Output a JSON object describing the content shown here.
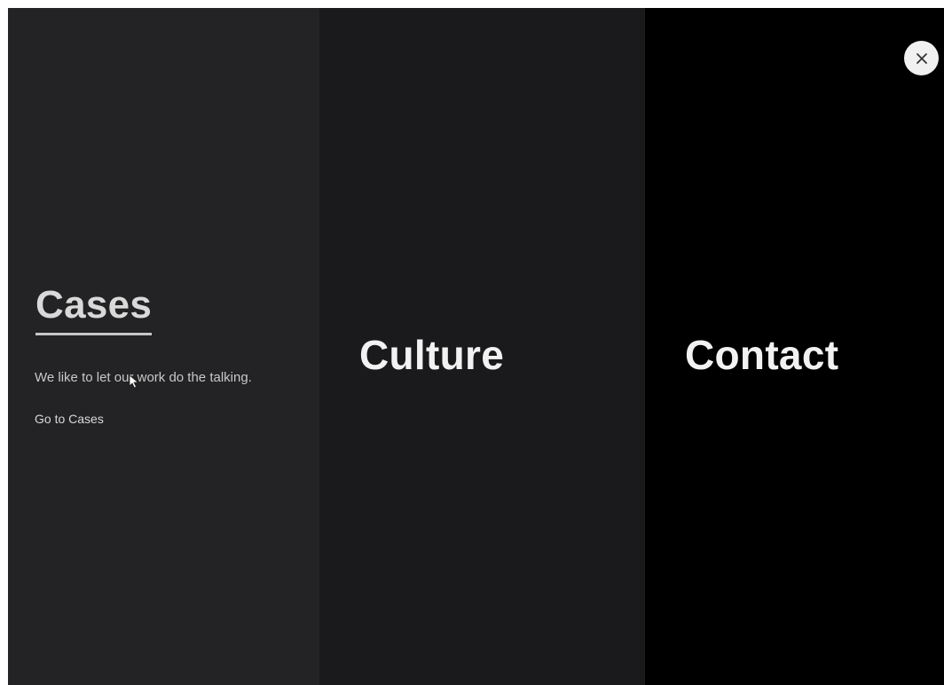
{
  "menu": {
    "panels": [
      {
        "id": "cases",
        "title": "Cases",
        "description": "We like to let our work do the talking.",
        "link_label": "Go to Cases",
        "background": "#232325"
      },
      {
        "id": "culture",
        "title": "Culture",
        "background": "#1a1a1c"
      },
      {
        "id": "contact",
        "title": "Contact",
        "background": "#000000"
      }
    ],
    "close_icon": "close-icon"
  }
}
